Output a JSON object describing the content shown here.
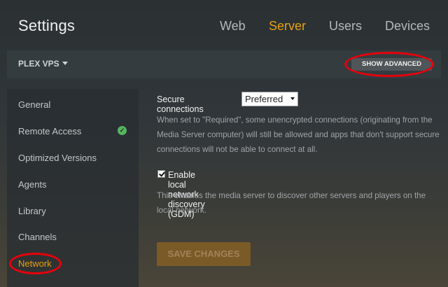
{
  "header": {
    "title": "Settings",
    "tabs": [
      {
        "label": "Web",
        "active": false
      },
      {
        "label": "Server",
        "active": true
      },
      {
        "label": "Users",
        "active": false
      },
      {
        "label": "Devices",
        "active": false
      }
    ]
  },
  "server_bar": {
    "server_name": "PLEX VPS",
    "show_advanced_label": "SHOW ADVANCED"
  },
  "sidebar": {
    "items": [
      {
        "label": "General"
      },
      {
        "label": "Remote Access",
        "status_icon": "check-circle-icon"
      },
      {
        "label": "Optimized Versions"
      },
      {
        "label": "Agents"
      },
      {
        "label": "Library"
      },
      {
        "label": "Channels"
      },
      {
        "label": "Network",
        "active": true
      }
    ]
  },
  "main": {
    "secure_connections": {
      "label": "Secure connections",
      "value": "Preferred",
      "help": "When set to \"Required\", some unencrypted connections (originating from the Media Server computer) will still be allowed and apps that don't support secure connections will not be able to connect at all."
    },
    "gdm": {
      "label": "Enable local network discovery (GDM)",
      "checked": true,
      "help": "This enables the media server to discover other servers and players on the local network."
    },
    "save_label": "SAVE CHANGES"
  },
  "colors": {
    "accent": "#e5a00d",
    "highlight_annotation": "#e8000b",
    "status_ok": "#57b560"
  }
}
